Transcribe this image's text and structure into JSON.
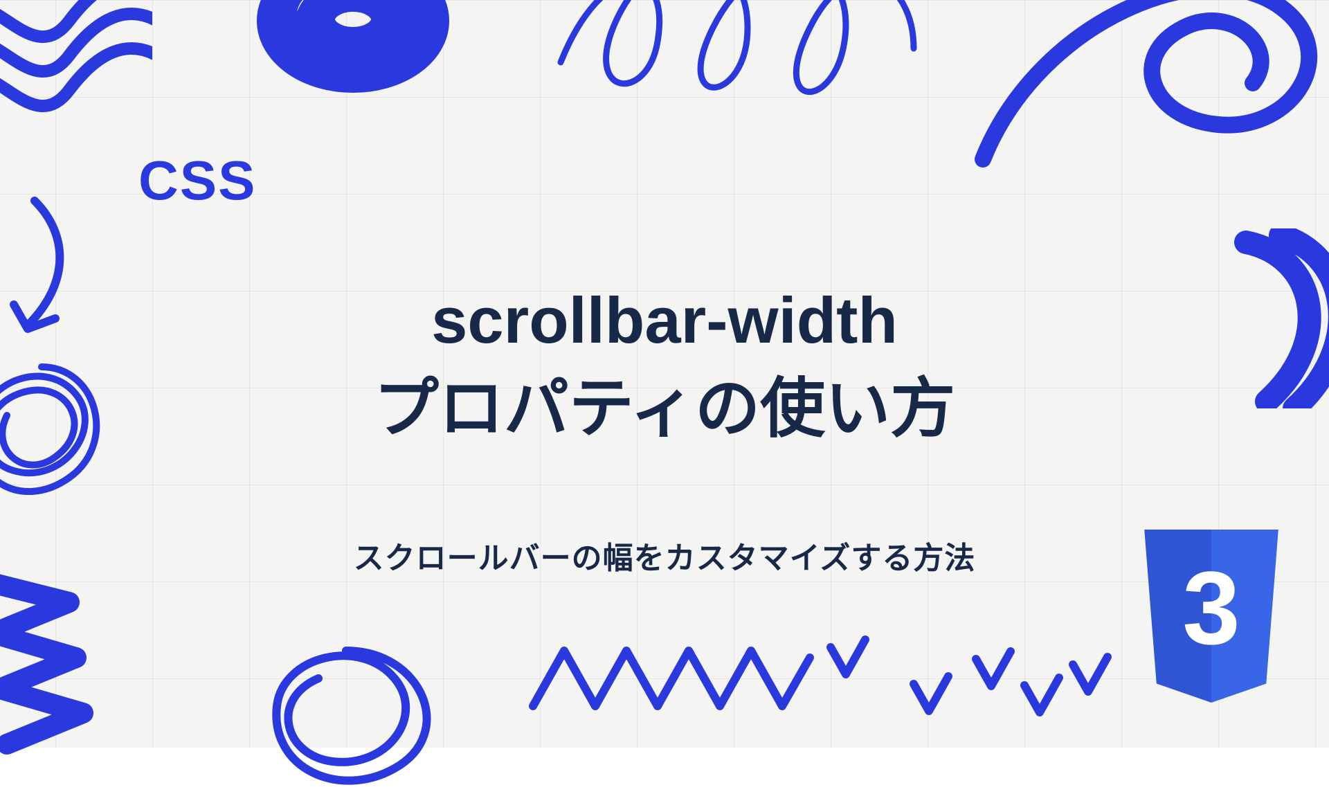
{
  "category": "CSS",
  "title_line1": "scrollbar-width",
  "title_line2": "プロパティの使い方",
  "subtitle": "スクロールバーの幅をカスタマイズする方法",
  "badge_label": "3",
  "colors": {
    "accent": "#2a39de",
    "text_dark": "#172849",
    "doodle": "#2a39de",
    "doodle_light": "#4a5ef0"
  }
}
